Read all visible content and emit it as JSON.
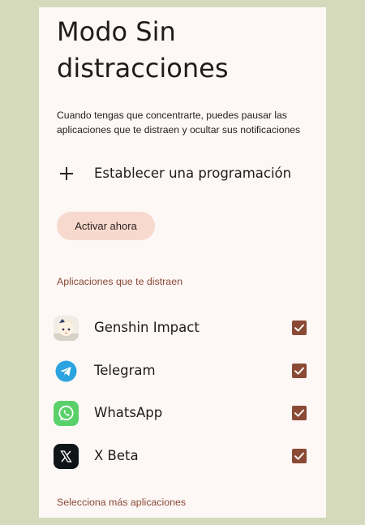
{
  "page": {
    "title": "Modo Sin distracciones",
    "description": "Cuando tengas que concentrarte, puedes pausar las aplicaciones que te distraen y ocultar sus notificaciones"
  },
  "schedule": {
    "icon": "plus-icon",
    "label": "Establecer una programación"
  },
  "activate_button": {
    "label": "Activar ahora"
  },
  "apps_section": {
    "title": "Aplicaciones que te distraen",
    "apps": [
      {
        "name": "Genshin Impact",
        "icon": "genshin-impact-icon",
        "checked": true
      },
      {
        "name": "Telegram",
        "icon": "telegram-icon",
        "checked": true
      },
      {
        "name": "WhatsApp",
        "icon": "whatsapp-icon",
        "checked": true
      },
      {
        "name": "X Beta",
        "icon": "x-beta-icon",
        "checked": true
      }
    ],
    "more_link": "Selecciona más aplicaciones"
  },
  "colors": {
    "background": "#d4dabb",
    "screen": "#fdf7f5",
    "accent": "#8a4a35",
    "button": "#f7d9ce",
    "telegram": "#2aa3e0",
    "whatsapp": "#5ad06a"
  }
}
